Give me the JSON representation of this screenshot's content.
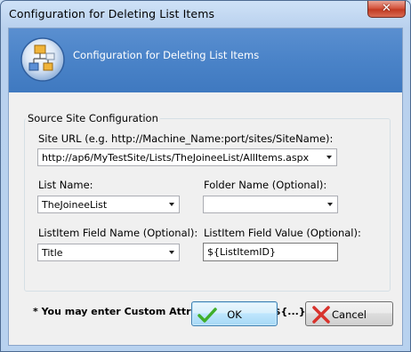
{
  "window": {
    "title": "Configuration for Deleting List Items",
    "close_glyph": "✕"
  },
  "banner": {
    "title": "Configuration for Deleting List Items",
    "icon": "org-chart-icon"
  },
  "group": {
    "label": "Source Site Configuration"
  },
  "fields": {
    "site_url": {
      "label": "Site URL (e.g. http://Machine_Name:port/sites/SiteName):",
      "value": "http://ap6/MyTestSite/Lists/TheJoineeList/AllItems.aspx"
    },
    "list_name": {
      "label": "List Name:",
      "value": "TheJoineeList"
    },
    "folder_name": {
      "label": "Folder Name (Optional):",
      "value": ""
    },
    "field_name": {
      "label": "ListItem Field Name (Optional):",
      "value": "Title"
    },
    "field_value": {
      "label": "ListItem Field Value (Optional):",
      "value": "${ListItemID}"
    }
  },
  "note": "* You may enter Custom Attribute Name as ${...}",
  "buttons": {
    "ok": "OK",
    "cancel": "Cancel"
  },
  "colors": {
    "banner": "#4a83c8",
    "ok_icon": "#3fae2a",
    "cancel_icon": "#d8322c"
  }
}
